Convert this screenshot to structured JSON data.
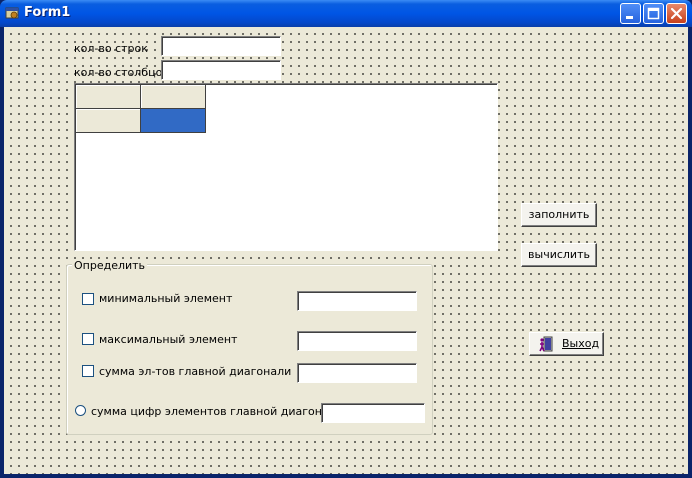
{
  "window": {
    "title": "Form1",
    "icons": {
      "app": "delphi-form-icon",
      "minimize": "minimize-icon",
      "maximize": "maximize-icon",
      "close": "close-icon"
    }
  },
  "form": {
    "rows_label": "кол-во строк",
    "rows_value": "",
    "cols_label": "кол-во столбцов",
    "cols_value": ""
  },
  "grid": {
    "rows": 2,
    "cols": 2,
    "cells": [
      [
        "",
        ""
      ],
      [
        "",
        ""
      ]
    ],
    "selected_color": "#316ac5"
  },
  "buttons": {
    "fill": "заполнить",
    "calc": "вычислить",
    "exit": "Выход",
    "exit_icon": "exit-door-icon"
  },
  "group": {
    "caption": "Определить",
    "min_label": "минимальный элемент",
    "min_checked": false,
    "min_value": "",
    "max_label": "максимальный элемент",
    "max_checked": false,
    "max_value": "",
    "diag_sum_label": "сумма  эл-тов главной диагонали",
    "diag_sum_checked": false,
    "diag_sum_value": "",
    "digit_sum_label": "сумма цифр элементов главной диагонали",
    "digit_sum_selected": false,
    "digit_sum_value": ""
  }
}
